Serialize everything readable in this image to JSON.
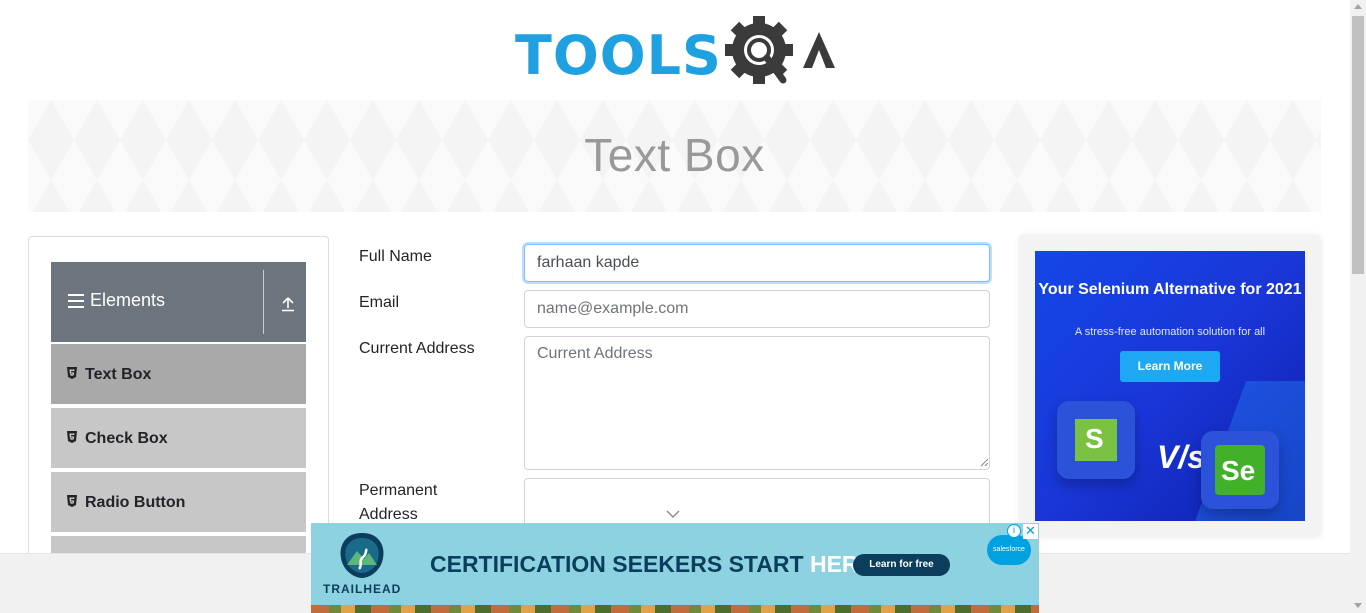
{
  "header": {
    "logo_text": "TOOLS",
    "logo_qa": "QA"
  },
  "banner": {
    "title": "Text Box"
  },
  "sidebar": {
    "group_title": "Elements",
    "items": [
      {
        "label": "Text Box",
        "active": true
      },
      {
        "label": "Check Box",
        "active": false
      },
      {
        "label": "Radio Button",
        "active": false
      }
    ]
  },
  "form": {
    "full_name_label": "Full Name",
    "full_name_value": "farhaan kapde",
    "email_label": "Email",
    "email_placeholder": "name@example.com",
    "current_address_label": "Current Address",
    "current_address_placeholder": "Current Address",
    "permanent_address_label": "Permanent Address"
  },
  "right_ad": {
    "headline": "Your Selenium Alternative for 2021",
    "subline": "A stress-free automation solution for all",
    "button": "Learn More",
    "vs": "V/s",
    "logo_left_letter": "S",
    "logo_right_letter": "Se"
  },
  "bottom_ad": {
    "brand": "TRAILHEAD",
    "headline_main": "CERTIFICATION SEEKERS START ",
    "headline_highlight": "HERE.",
    "button": "Learn for free",
    "partner": "salesforce",
    "info_icon": "i",
    "close_icon": "✕"
  },
  "colors": {
    "logo_blue": "#1fa0e0",
    "logo_dark": "#3b3b3b",
    "sidebar_header": "#6c757d",
    "menu_active": "#a9a9a9",
    "menu_item": "#c7c7c7",
    "focus_border": "#80bdff",
    "ad_blue": "#1447e6",
    "ad_teal": "#8cd2e0"
  },
  "icons": {
    "hamburger": "bars-icon",
    "collapse": "upload-icon",
    "menu_item": "html5-icon",
    "select": "chevron-down-icon"
  }
}
